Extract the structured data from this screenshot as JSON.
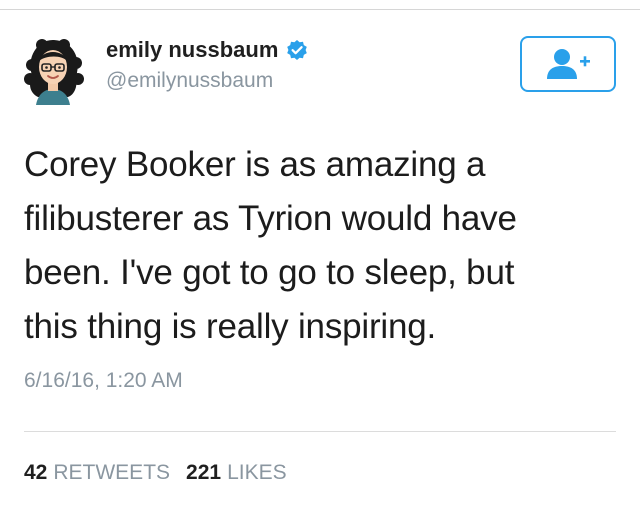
{
  "tweet": {
    "author": {
      "display_name": "emily nussbaum",
      "handle": "@emilynussbaum",
      "verified": true,
      "avatar_icon": "cartoon-avatar"
    },
    "follow_button": {
      "icon": "add-user-icon",
      "color": "#2aa0ea"
    },
    "text": "Corey Booker is as amazing a\nfilibusterer as Tyrion would have\nbeen. I've got to go to sleep, but\nthis thing is really inspiring.",
    "timestamp": "6/16/16, 1:20 AM",
    "stats": {
      "retweets_count": "42",
      "retweets_label": "RETWEETS",
      "likes_count": "221",
      "likes_label": "LIKES"
    }
  },
  "colors": {
    "accent": "#2aa0ea",
    "muted_text": "#8a96a0",
    "primary_text": "#1c1c1c"
  }
}
